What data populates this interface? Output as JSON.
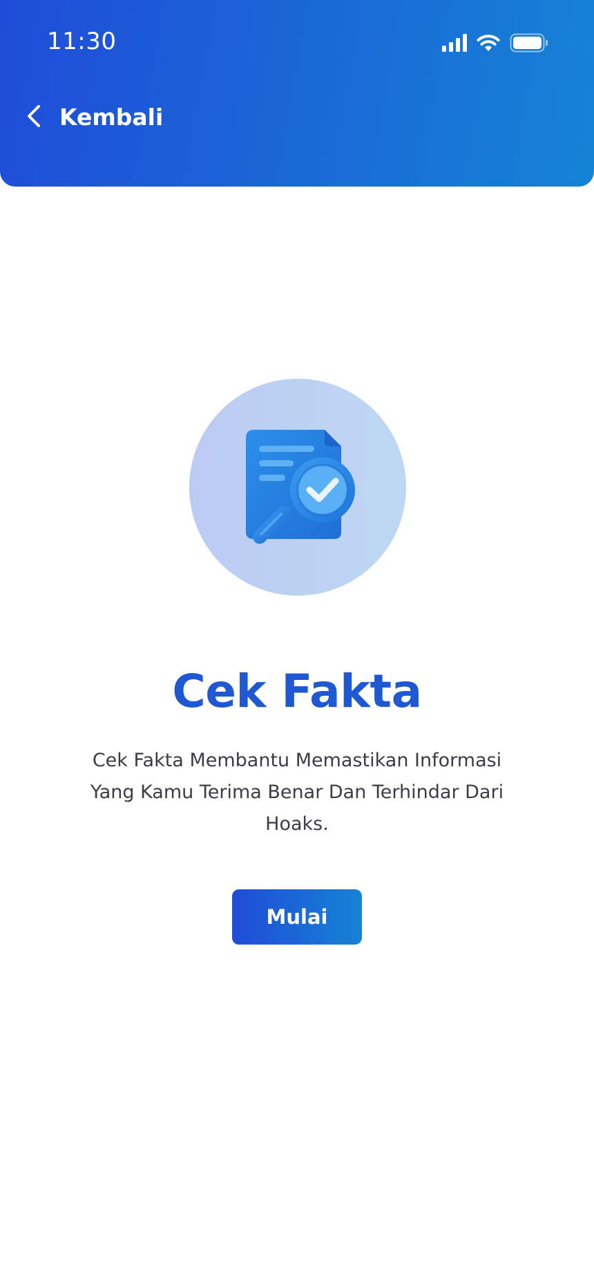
{
  "status_bar": {
    "time": "11:30",
    "icons": [
      "cellular-signal-icon",
      "wifi-icon",
      "battery-icon"
    ]
  },
  "header": {
    "back_icon": "chevron-left-icon",
    "back_label": "Kembali"
  },
  "hero": {
    "icon": "document-magnifier-check-icon"
  },
  "main": {
    "title": "Cek Fakta",
    "description": "Cek Fakta Membantu Memastikan Informasi Yang Kamu Terima Benar Dan Terhindar Dari Hoaks.",
    "start_button_label": "Mulai"
  },
  "colors": {
    "header_gradient_start": "#1f4cd8",
    "header_gradient_end": "#1583d6",
    "title": "#1e58d2",
    "body_text": "#3b3d44",
    "hero_circle": "#bdd0f3",
    "icon_blue": "#2a8ee8"
  }
}
